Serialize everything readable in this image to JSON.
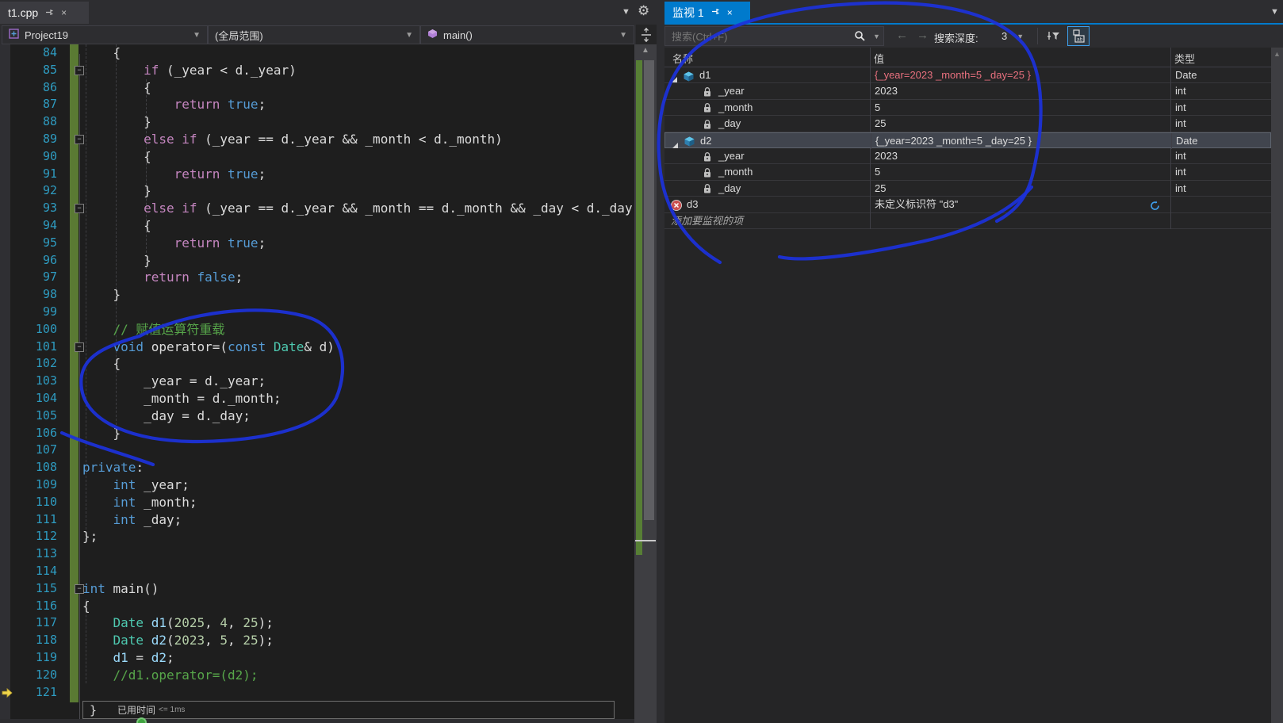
{
  "editor": {
    "tab": {
      "title": "t1.cpp"
    },
    "nav": {
      "project": "Project19",
      "scope": "(全局范围)",
      "function": "main()"
    },
    "perf_tip": {
      "brace": "}",
      "label": "已用时间",
      "value": "<= 1ms"
    },
    "code": {
      "fold_lines": [
        85,
        89,
        93,
        101,
        115
      ],
      "exec_line": 121,
      "lines": [
        {
          "n": 84,
          "s": [
            [
              "p",
              "    {"
            ]
          ]
        },
        {
          "n": 85,
          "s": [
            [
              "p",
              "        "
            ],
            [
              "k",
              "if"
            ],
            [
              "p",
              " (_year < d._year)"
            ]
          ]
        },
        {
          "n": 86,
          "s": [
            [
              "p",
              "        {"
            ]
          ]
        },
        {
          "n": 87,
          "s": [
            [
              "p",
              "            "
            ],
            [
              "k",
              "return"
            ],
            [
              "p",
              " "
            ],
            [
              "b",
              "true"
            ],
            [
              "p",
              ";"
            ]
          ]
        },
        {
          "n": 88,
          "s": [
            [
              "p",
              "        }"
            ]
          ]
        },
        {
          "n": 89,
          "s": [
            [
              "p",
              "        "
            ],
            [
              "k",
              "else"
            ],
            [
              "p",
              " "
            ],
            [
              "k",
              "if"
            ],
            [
              "p",
              " (_year == d._year && _month < d._month)"
            ]
          ]
        },
        {
          "n": 90,
          "s": [
            [
              "p",
              "        {"
            ]
          ]
        },
        {
          "n": 91,
          "s": [
            [
              "p",
              "            "
            ],
            [
              "k",
              "return"
            ],
            [
              "p",
              " "
            ],
            [
              "b",
              "true"
            ],
            [
              "p",
              ";"
            ]
          ]
        },
        {
          "n": 92,
          "s": [
            [
              "p",
              "        }"
            ]
          ]
        },
        {
          "n": 93,
          "s": [
            [
              "p",
              "        "
            ],
            [
              "k",
              "else"
            ],
            [
              "p",
              " "
            ],
            [
              "k",
              "if"
            ],
            [
              "p",
              " (_year == d._year && _month == d._month && _day < d._day)"
            ]
          ]
        },
        {
          "n": 94,
          "s": [
            [
              "p",
              "        {"
            ]
          ]
        },
        {
          "n": 95,
          "s": [
            [
              "p",
              "            "
            ],
            [
              "k",
              "return"
            ],
            [
              "p",
              " "
            ],
            [
              "b",
              "true"
            ],
            [
              "p",
              ";"
            ]
          ]
        },
        {
          "n": 96,
          "s": [
            [
              "p",
              "        }"
            ]
          ]
        },
        {
          "n": 97,
          "s": [
            [
              "p",
              "        "
            ],
            [
              "k",
              "return"
            ],
            [
              "p",
              " "
            ],
            [
              "b",
              "false"
            ],
            [
              "p",
              ";"
            ]
          ]
        },
        {
          "n": 98,
          "s": [
            [
              "p",
              "    }"
            ]
          ]
        },
        {
          "n": 99,
          "s": []
        },
        {
          "n": 100,
          "s": [
            [
              "c",
              "    // 赋值运算符重载"
            ]
          ]
        },
        {
          "n": 101,
          "s": [
            [
              "p",
              "    "
            ],
            [
              "b",
              "void"
            ],
            [
              "p",
              " operator=("
            ],
            [
              "b",
              "const"
            ],
            [
              "p",
              " "
            ],
            [
              "t",
              "Date"
            ],
            [
              "p",
              "& d)"
            ]
          ]
        },
        {
          "n": 102,
          "s": [
            [
              "p",
              "    {"
            ]
          ]
        },
        {
          "n": 103,
          "s": [
            [
              "p",
              "        _year = d._year;"
            ]
          ]
        },
        {
          "n": 104,
          "s": [
            [
              "p",
              "        _month = d._month;"
            ]
          ]
        },
        {
          "n": 105,
          "s": [
            [
              "p",
              "        _day = d._day;"
            ]
          ]
        },
        {
          "n": 106,
          "s": [
            [
              "p",
              "    }"
            ]
          ]
        },
        {
          "n": 107,
          "s": []
        },
        {
          "n": 108,
          "s": [
            [
              "b",
              "private"
            ],
            [
              "p",
              ":"
            ]
          ]
        },
        {
          "n": 109,
          "s": [
            [
              "p",
              "    "
            ],
            [
              "b",
              "int"
            ],
            [
              "p",
              " _year;"
            ]
          ]
        },
        {
          "n": 110,
          "s": [
            [
              "p",
              "    "
            ],
            [
              "b",
              "int"
            ],
            [
              "p",
              " _month;"
            ]
          ]
        },
        {
          "n": 111,
          "s": [
            [
              "p",
              "    "
            ],
            [
              "b",
              "int"
            ],
            [
              "p",
              " _day;"
            ]
          ]
        },
        {
          "n": 112,
          "s": [
            [
              "p",
              "};"
            ]
          ]
        },
        {
          "n": 113,
          "s": []
        },
        {
          "n": 114,
          "s": []
        },
        {
          "n": 115,
          "s": [
            [
              "b",
              "int"
            ],
            [
              "p",
              " main()"
            ]
          ]
        },
        {
          "n": 116,
          "s": [
            [
              "p",
              "{"
            ]
          ]
        },
        {
          "n": 117,
          "s": [
            [
              "p",
              "    "
            ],
            [
              "t",
              "Date"
            ],
            [
              "p",
              " "
            ],
            [
              "v",
              "d1"
            ],
            [
              "p",
              "("
            ],
            [
              "n",
              "2025"
            ],
            [
              "p",
              ", "
            ],
            [
              "n",
              "4"
            ],
            [
              "p",
              ", "
            ],
            [
              "n",
              "25"
            ],
            [
              "p",
              ");"
            ]
          ]
        },
        {
          "n": 118,
          "s": [
            [
              "p",
              "    "
            ],
            [
              "t",
              "Date"
            ],
            [
              "p",
              " "
            ],
            [
              "v",
              "d2"
            ],
            [
              "p",
              "("
            ],
            [
              "n",
              "2023"
            ],
            [
              "p",
              ", "
            ],
            [
              "n",
              "5"
            ],
            [
              "p",
              ", "
            ],
            [
              "n",
              "25"
            ],
            [
              "p",
              ");"
            ]
          ]
        },
        {
          "n": 119,
          "s": [
            [
              "p",
              "    "
            ],
            [
              "v",
              "d1"
            ],
            [
              "p",
              " = "
            ],
            [
              "v",
              "d2"
            ],
            [
              "p",
              ";"
            ]
          ]
        },
        {
          "n": 120,
          "s": [
            [
              "c",
              "    //d1.operator=(d2);"
            ]
          ]
        },
        {
          "n": 121,
          "s": []
        }
      ]
    }
  },
  "watch": {
    "tab": {
      "title": "监视 1"
    },
    "toolbar": {
      "search_placeholder": "搜索(Ctrl+F)",
      "depth_label": "搜索深度:",
      "depth_value": "3"
    },
    "columns": {
      "name": "名称",
      "value": "值",
      "type": "类型"
    },
    "rows": [
      {
        "name": "d1",
        "value": "{_year=2023 _month=5 _day=25 }",
        "type": "Date",
        "icon": "class",
        "expanded": true,
        "changed": true
      },
      {
        "name": "_year",
        "value": "2023",
        "type": "int",
        "icon": "member",
        "child": true
      },
      {
        "name": "_month",
        "value": "5",
        "type": "int",
        "icon": "member",
        "child": true
      },
      {
        "name": "_day",
        "value": "25",
        "type": "int",
        "icon": "member",
        "child": true
      },
      {
        "name": "d2",
        "value": "{_year=2023 _month=5 _day=25 }",
        "type": "Date",
        "icon": "class",
        "expanded": true,
        "selected": true
      },
      {
        "name": "_year",
        "value": "2023",
        "type": "int",
        "icon": "member",
        "child": true
      },
      {
        "name": "_month",
        "value": "5",
        "type": "int",
        "icon": "member",
        "child": true
      },
      {
        "name": "_day",
        "value": "25",
        "type": "int",
        "icon": "member",
        "child": true
      },
      {
        "name": "d3",
        "value": "未定义标识符 \"d3\"",
        "type": "",
        "icon": "error",
        "refresh": true
      },
      {
        "name": "添加要监视的项",
        "value": "",
        "type": "",
        "icon": "none",
        "ghost": true
      }
    ]
  },
  "colors": {
    "accent_blue": "#007ACC",
    "changed_value_red": "#E8707E",
    "comment_green": "#57A64A",
    "keyword_purple": "#C586C0",
    "keyword_blue": "#569CD6",
    "type_teal": "#4EC9B0",
    "number_green": "#B5CEA8",
    "local_var_blue": "#9CDCFE",
    "line_number_teal": "#2E9BC0",
    "changed_lines_bar": "#5A7A33",
    "ink_color": "#1C31DA"
  }
}
